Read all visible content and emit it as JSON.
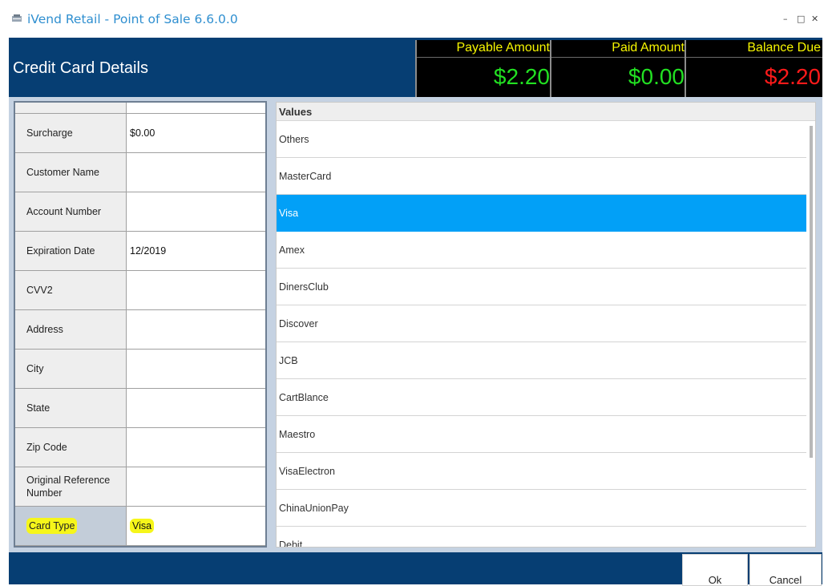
{
  "window": {
    "title": "iVend Retail - Point of Sale 6.6.0.0",
    "controls": {
      "minimize": "–",
      "maximize": "□",
      "close": "✕"
    }
  },
  "header": {
    "title": "Credit Card Details",
    "amounts": [
      {
        "label": "Payable Amount",
        "value": "$2.20",
        "color": "#22e022"
      },
      {
        "label": "Paid Amount",
        "value": "$0.00",
        "color": "#22e022"
      },
      {
        "label": "Balance Due",
        "value": "$2.20",
        "color": "#ff1a1a"
      }
    ]
  },
  "fields": [
    {
      "label": "",
      "value": ""
    },
    {
      "label": "Surcharge",
      "value": "$0.00"
    },
    {
      "label": "Customer Name",
      "value": ""
    },
    {
      "label": "Account Number",
      "value": ""
    },
    {
      "label": "Expiration Date",
      "value": "12/2019"
    },
    {
      "label": "CVV2",
      "value": ""
    },
    {
      "label": "Address",
      "value": ""
    },
    {
      "label": "City",
      "value": ""
    },
    {
      "label": "State",
      "value": ""
    },
    {
      "label": "Zip Code",
      "value": ""
    },
    {
      "label": "Original Reference Number",
      "value": ""
    },
    {
      "label": "Card Type",
      "value": "Visa"
    }
  ],
  "values_list": {
    "header": "Values",
    "items": [
      "Others",
      "MasterCard",
      "Visa",
      "Amex",
      "DinersClub",
      "Discover",
      "JCB",
      "CartBlance",
      "Maestro",
      "VisaElectron",
      "ChinaUnionPay",
      "Debit"
    ],
    "selected": "Visa"
  },
  "footer": {
    "ok_label": "Ok",
    "cancel_label": "Cancel"
  },
  "colors": {
    "brand_navy": "#063e73",
    "selection_blue": "#02a0f7",
    "highlight_yellow": "#f6f61a",
    "label_yellow": "#f7f700"
  }
}
